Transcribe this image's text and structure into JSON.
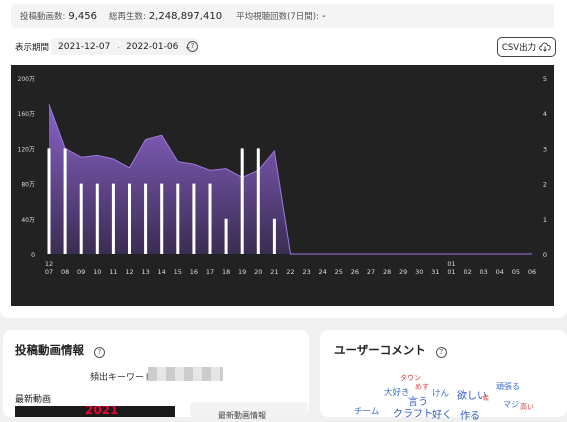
{
  "stats": {
    "post_count_label": "投稿動画数:",
    "post_count": "9,456",
    "total_views_label": "総再生数:",
    "total_views": "2,248,897,410",
    "avg_views_label": "平均視聴回数(7日間):",
    "avg_views": "-"
  },
  "filter": {
    "period_label": "表示期間",
    "start_date": "2021-12-07",
    "end_date": "2022-01-06",
    "help": "?",
    "csv_label": "CSV出力"
  },
  "chart_data": {
    "type": "bar",
    "categories": [
      "07",
      "08",
      "09",
      "10",
      "11",
      "12",
      "13",
      "14",
      "15",
      "16",
      "17",
      "18",
      "19",
      "20",
      "21",
      "22",
      "23",
      "24",
      "25",
      "26",
      "27",
      "28",
      "29",
      "30",
      "31",
      "01",
      "02",
      "03",
      "04",
      "05",
      "06"
    ],
    "month_labels": [
      {
        "index": 0,
        "label": "12"
      },
      {
        "index": 25,
        "label": "01"
      }
    ],
    "series": [
      {
        "kind": "bar",
        "axis": "right",
        "values": [
          3,
          3,
          2,
          2,
          2,
          2,
          2,
          2,
          2,
          2,
          2,
          1,
          3,
          3,
          1,
          0,
          0,
          0,
          0,
          0,
          0,
          0,
          0,
          0,
          0,
          0,
          0,
          0,
          0,
          0,
          0
        ]
      },
      {
        "kind": "area",
        "axis": "left",
        "values": [
          1700000,
          1200000,
          1100000,
          1120000,
          1080000,
          980000,
          1300000,
          1350000,
          1050000,
          1020000,
          950000,
          970000,
          870000,
          950000,
          1170000,
          0,
          0,
          0,
          0,
          0,
          0,
          0,
          0,
          0,
          0,
          0,
          0,
          0,
          0,
          0,
          0
        ]
      }
    ],
    "left_ticks": [
      "0",
      "40万",
      "80万",
      "120万",
      "160万",
      "200万"
    ],
    "right_ticks": [
      "0",
      "1",
      "2",
      "3",
      "4",
      "5"
    ],
    "ylim_left": [
      0,
      2000000
    ],
    "ylim_right": [
      0,
      5
    ],
    "colors": {
      "area_top": "#8a63c9",
      "area_bottom": "#3a2d52",
      "bar": "#ffffff",
      "bg": "#222222",
      "text": "#dddddd"
    }
  },
  "posted_videos": {
    "title": "投稿動画情報",
    "help": "?",
    "keyword_label": "頻出キーワード:",
    "latest_label": "最新動画",
    "thumb_text": "2021",
    "newest_info_label": "最新動画情報"
  },
  "user_comments": {
    "title": "ユーザーコメント",
    "help": "?",
    "words": [
      {
        "text": "タウン",
        "color": "#d23a3a",
        "size": 7
      },
      {
        "text": "大好き",
        "color": "#3a6fd2",
        "size": 8.5
      },
      {
        "text": "めす",
        "color": "#d23a3a",
        "size": 7
      },
      {
        "text": "けん",
        "color": "#3a6fd2",
        "size": 8.5
      },
      {
        "text": "欲しい",
        "color": "#2f58c4",
        "size": 10
      },
      {
        "text": "絵",
        "color": "#d23a3a",
        "size": 6
      },
      {
        "text": "頑張る",
        "color": "#3a6fd2",
        "size": 8
      },
      {
        "text": "言う",
        "color": "#2f58c4",
        "size": 10
      },
      {
        "text": "マジ",
        "color": "#3a6fd2",
        "size": 8
      },
      {
        "text": "高い",
        "color": "#d23a3a",
        "size": 7
      },
      {
        "text": "チーム",
        "color": "#3a6fd2",
        "size": 8.5
      },
      {
        "text": "クラフト",
        "color": "#2f58c4",
        "size": 10
      },
      {
        "text": "好く",
        "color": "#2f58c4",
        "size": 10
      },
      {
        "text": "作る",
        "color": "#2f58c4",
        "size": 10
      }
    ]
  }
}
